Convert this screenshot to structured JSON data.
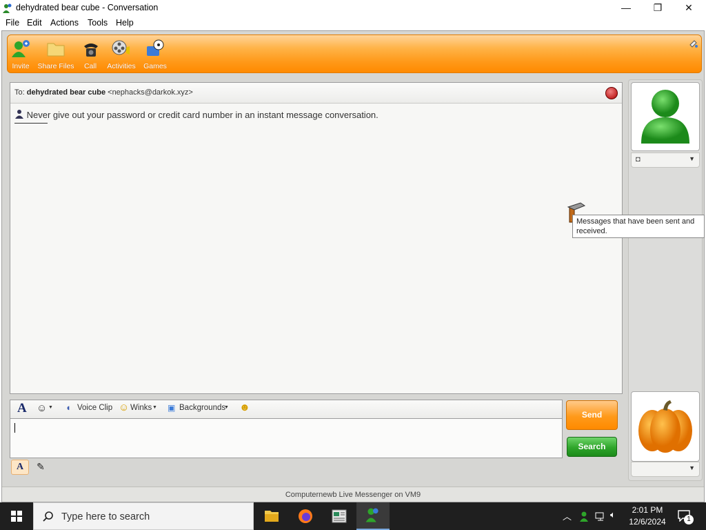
{
  "window": {
    "title": "dehydrated bear cube - Conversation",
    "minimize_glyph": "—",
    "restore_glyph": "❐",
    "close_glyph": "✕"
  },
  "menu": {
    "items": [
      "File",
      "Edit",
      "Actions",
      "Tools",
      "Help"
    ]
  },
  "toolbar": {
    "buttons": [
      {
        "label": "Invite",
        "icon": "invite-icon"
      },
      {
        "label": "Share Files",
        "icon": "folder-icon"
      },
      {
        "label": "Call",
        "icon": "phone-icon"
      },
      {
        "label": "Activities",
        "icon": "film-reel-icon"
      },
      {
        "label": "Games",
        "icon": "games-icon"
      }
    ]
  },
  "conversation": {
    "to_prefix": "To:",
    "contact_name": "dehydrated bear cube",
    "contact_email": "<nephacks@darkok.xyz>",
    "warning": "Never give out your password or credit card number in an instant message conversation."
  },
  "tooltip": {
    "text": "Messages that have been sent and received."
  },
  "compose_tools": {
    "voice_clip": "Voice Clip",
    "winks": "Winks",
    "backgrounds": "Backgrounds"
  },
  "compose": {
    "value": ""
  },
  "buttons": {
    "send": "Send",
    "search": "Search"
  },
  "statusbar": {
    "text": "Computernewb Live Messenger on VM9"
  },
  "taskbar": {
    "search_placeholder": "Type here to search",
    "time": "2:01 PM",
    "date": "12/6/2024",
    "notification_count": "1"
  },
  "colors": {
    "toolbar_orange": "#ff9a1a",
    "send_orange": "#ff8a00",
    "search_green": "#2ea52a",
    "taskbar": "#1f1f1f"
  }
}
